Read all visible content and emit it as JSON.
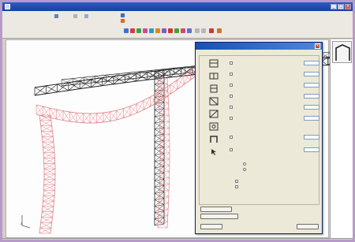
{
  "window": {
    "title": "",
    "controls": [
      "_",
      "□",
      "×"
    ]
  },
  "toolbar": {
    "info_line_1": "",
    "info_line_2": "",
    "zoom_value": ""
  },
  "viewport": {
    "axis_label": "z"
  },
  "dialog": {
    "title": "",
    "subtitle": "",
    "options": [
      {
        "label": "",
        "value": ""
      },
      {
        "label": "",
        "value": ""
      },
      {
        "label": "",
        "value": ""
      },
      {
        "label": "",
        "value": ""
      },
      {
        "label": "",
        "value": ""
      },
      {
        "label": "",
        "value": ""
      },
      {
        "label": "",
        "value": ""
      },
      {
        "label": "",
        "value": ""
      }
    ],
    "radio_1": "",
    "radio_2": "",
    "check_1": "",
    "check_2": "",
    "button_apply": "",
    "button_combinations": "",
    "field_text": "",
    "button_ok": "",
    "button_cancel": ""
  },
  "right_panel": {
    "items": [
      "",
      "",
      "",
      "",
      "",
      "",
      "",
      "",
      "",
      "",
      "",
      ""
    ]
  },
  "status_bar": {
    "text": ""
  },
  "colors": {
    "structure_black": "#1c1c1c",
    "structure_red": "#e07f86",
    "titlebar_blue": "#1a4fb4",
    "frame_purple": "#b89ac9"
  }
}
